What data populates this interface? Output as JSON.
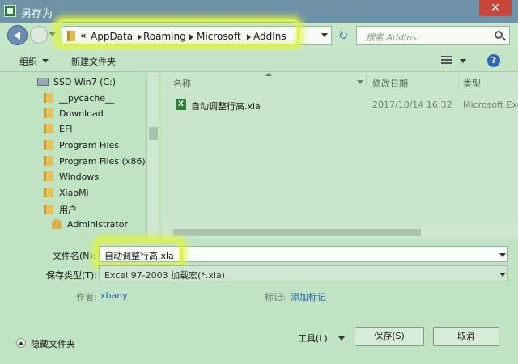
{
  "window": {
    "title": "另存为",
    "close_glyph": "✕"
  },
  "address_bar": {
    "overflow": "«",
    "crumbs": [
      "AppData",
      "Roaming",
      "Microsoft",
      "AddIns"
    ],
    "refresh_glyph": "↻"
  },
  "search": {
    "placeholder": "搜索 AddIns"
  },
  "toolbar": {
    "organize": "组织",
    "new_folder": "新建文件夹",
    "help_glyph": "?"
  },
  "nav": {
    "items": [
      "SSD Win7 (C:)",
      "__pycache__",
      "Download",
      "EFI",
      "Program Files",
      "Program Files (x86)",
      "Windows",
      "XiaoMi",
      "用户",
      "Administrator"
    ]
  },
  "file_list": {
    "columns": [
      "名称",
      "修改日期",
      "类型"
    ],
    "rows": [
      {
        "name": "自动调整行高.xla",
        "date": "2017/10/14 16:32",
        "type": "Microsoft Excel",
        "icon_glyph": "X"
      }
    ]
  },
  "form": {
    "filename_label": "文件名(N):",
    "filename_value": "自动调整行高.xla",
    "filetype_label": "保存类型(T):",
    "filetype_value": "Excel 97-2003 加载宏(*.xla)",
    "author_label": "作者:",
    "author_value": "xbany",
    "tags_label": "标记:",
    "tags_value": "添加标记"
  },
  "footer": {
    "hide_folders": "隐藏文件夹",
    "tools": "工具(L)",
    "save": "保存(S)",
    "cancel": "取消"
  }
}
